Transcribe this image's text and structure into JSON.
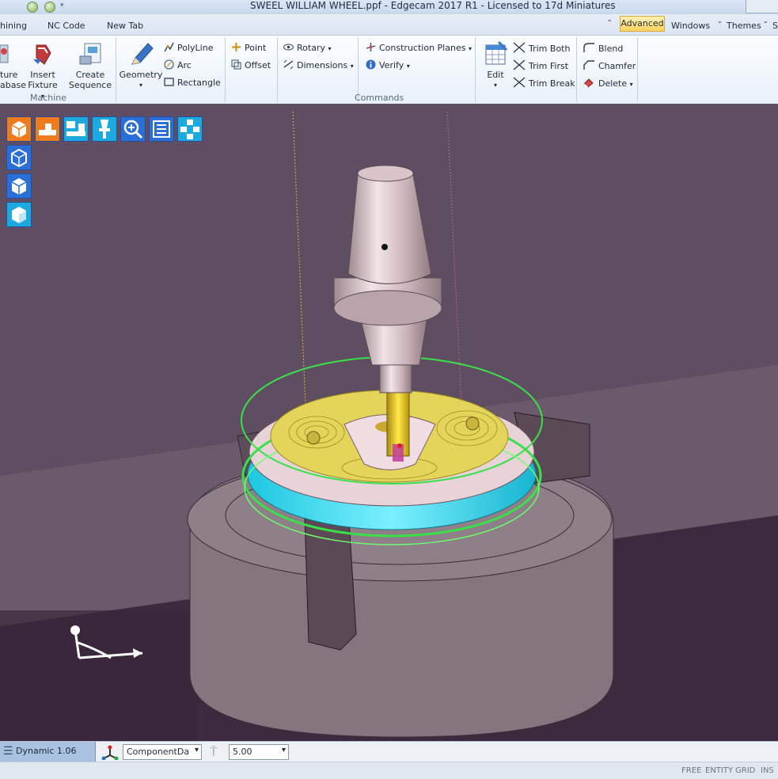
{
  "window": {
    "title": "SWEEL WILLIAM WHEEL.ppf - Edgecam 2017 R1  -  Licensed to 17d Miniatures"
  },
  "tabs": {
    "machining": "hining",
    "nc_code": "NC Code",
    "new_tab": "New Tab",
    "advanced": "Advanced",
    "windows": "Windows",
    "themes": "Themes",
    "s": "S"
  },
  "ribbon": {
    "machine": {
      "fixture_database": [
        "ture",
        "abase"
      ],
      "insert_fixture": [
        "Insert",
        "Fixture"
      ],
      "create_sequence": [
        "Create",
        "Sequence"
      ],
      "group_label": "Machine"
    },
    "commands": {
      "geometry": "Geometry",
      "polyline": "PolyLine",
      "arc": "Arc",
      "rectangle": "Rectangle",
      "point": "Point",
      "offset": "Offset",
      "rotary": "Rotary",
      "dimensions": "Dimensions",
      "construction_planes": "Construction Planes",
      "verify": "Verify",
      "edit": "Edit",
      "trim_both": "Trim Both",
      "trim_first": "Trim First",
      "trim_break": "Trim Break",
      "blend": "Blend",
      "chamfer": "Chamfer",
      "delete": "Delete",
      "group_label": "Commands"
    }
  },
  "viewport": {
    "background_color": "#615063",
    "toolbar_icons": [
      "solid-view-icon",
      "machine-bed-icon",
      "machine-layout-icon",
      "tool-holder-icon",
      "zoom-icon",
      "list-icon",
      "grid-layout-icon",
      "view-iso-icon",
      "view-wire-icon",
      "view-shaded-icon"
    ]
  },
  "statusbar": {
    "mode": "Dynamic 1.06",
    "datum": "ComponentDatu",
    "value": "5.00",
    "flags": [
      "FREE",
      "ENTITY",
      "GRID",
      "INS"
    ]
  }
}
